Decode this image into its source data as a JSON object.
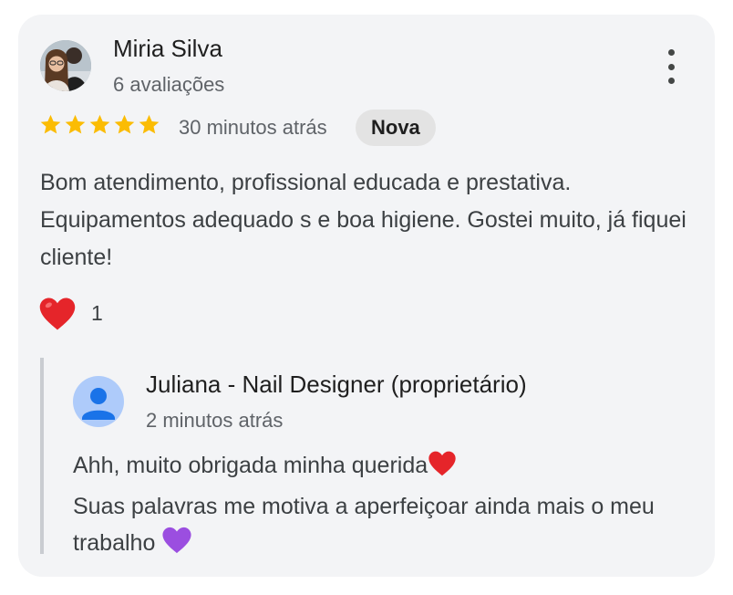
{
  "review": {
    "author": "Miria Silva",
    "author_meta": "6 avaliações",
    "rating": 5,
    "time": "30 minutos atrás",
    "badge": "Nova",
    "text": "Bom atendimento, profissional educada e prestativa. Equipamentos adequado s e boa higiene. Gostei muito, já fiquei cliente!",
    "reaction_icon": "red-heart-icon",
    "reaction_count": "1"
  },
  "reply": {
    "author": "Juliana - Nail Designer (proprietário)",
    "time": "2 minutos atrás",
    "line1": "Ahh, muito obrigada minha querida",
    "line2": "Suas palavras me motiva a aperfeiçoar ainda mais o meu trabalho"
  },
  "colors": {
    "card_bg": "#f3f4f6",
    "star": "#fbbc04",
    "heart": "#e5252a",
    "purple_heart": "#9b4ee0",
    "badge_bg": "#e3e3e3",
    "avatar_default_bg": "#aecbfa",
    "avatar_default_fg": "#1a73e8"
  }
}
